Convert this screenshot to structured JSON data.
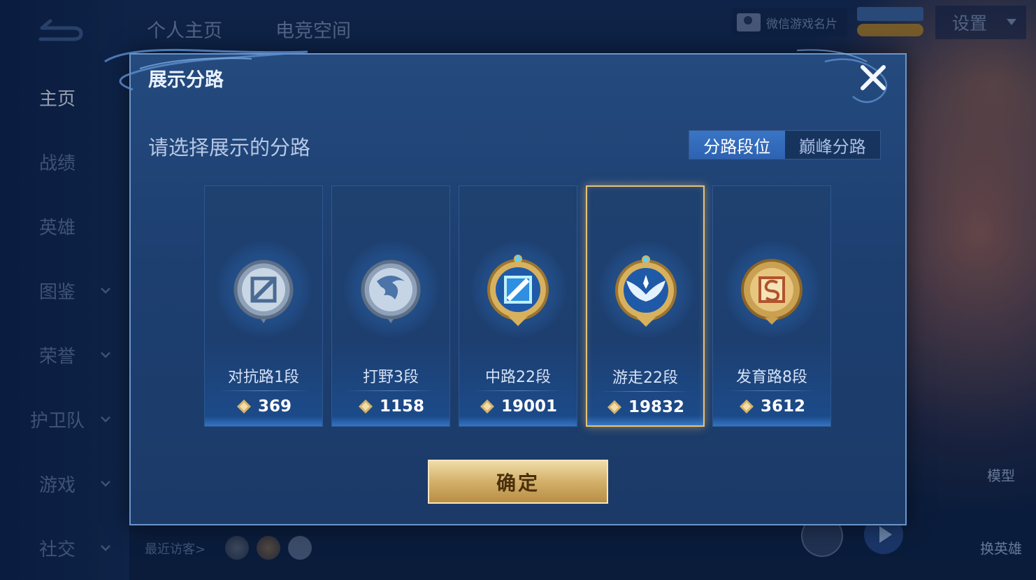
{
  "nav": {
    "tabs": [
      "个人主页",
      "电竞空间"
    ],
    "sidebar": [
      {
        "label": "主页",
        "active": true,
        "chevron": false
      },
      {
        "label": "战绩",
        "active": false,
        "chevron": false
      },
      {
        "label": "英雄",
        "active": false,
        "chevron": false
      },
      {
        "label": "图鉴",
        "active": false,
        "chevron": true
      },
      {
        "label": "荣誉",
        "active": false,
        "chevron": true
      },
      {
        "label": "护卫队",
        "active": false,
        "chevron": true
      },
      {
        "label": "游戏",
        "active": false,
        "chevron": true
      },
      {
        "label": "社交",
        "active": false,
        "chevron": true
      }
    ]
  },
  "topbar": {
    "wechat_card": "微信游戏名片",
    "settings": "设置"
  },
  "footer": {
    "recent_visitors": "最近访客>"
  },
  "right_buttons": {
    "model": "模型",
    "switch_hero": "换英雄"
  },
  "modal": {
    "title": "展示分路",
    "subtitle": "请选择展示的分路",
    "segmented": {
      "options": [
        "分路段位",
        "巅峰分路"
      ],
      "selected": 0
    },
    "cards": [
      {
        "label": "对抗路1段",
        "score": "369",
        "emblem": "sword-emblem-icon",
        "tier": "silver",
        "selected": false
      },
      {
        "label": "打野3段",
        "score": "1158",
        "emblem": "dragon-emblem-icon",
        "tier": "silver",
        "selected": false
      },
      {
        "label": "中路22段",
        "score": "19001",
        "emblem": "staff-emblem-icon",
        "tier": "gold-blue",
        "selected": false
      },
      {
        "label": "游走22段",
        "score": "19832",
        "emblem": "wings-emblem-icon",
        "tier": "gold-blue",
        "selected": true
      },
      {
        "label": "发育路8段",
        "score": "3612",
        "emblem": "arrow-emblem-icon",
        "tier": "gold",
        "selected": false
      }
    ],
    "confirm": "确定"
  },
  "colors": {
    "accent_gold": "#e4c27a",
    "tab_active": "#2d62b1",
    "panel": "#1d3f70"
  }
}
